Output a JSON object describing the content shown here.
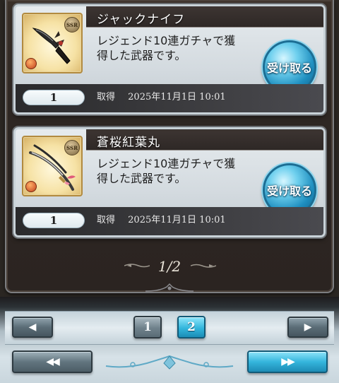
{
  "items": [
    {
      "name": "ジャックナイフ",
      "description_line1": "レジェンド10連ガチャで獲",
      "description_line2": "得した武器です。",
      "quantity": "1",
      "acquired_label": "取得",
      "acquired_date": "2025年11月1日 10:01",
      "receive_label": "受け取る",
      "rarity_badge": "SSR",
      "icon": "dagger-icon",
      "element_color": "#e0601f"
    },
    {
      "name": "蒼桜紅葉丸",
      "description_line1": "レジェンド10連ガチャで獲",
      "description_line2": "得した武器です。",
      "quantity": "1",
      "acquired_label": "取得",
      "acquired_date": "2025年11月1日 10:01",
      "receive_label": "受け取る",
      "rarity_badge": "SSR",
      "icon": "katana-icon",
      "element_color": "#e0601f"
    }
  ],
  "pagination": {
    "indicator": "1/2",
    "prev_icon": "◀",
    "next_icon": "▶",
    "first_icon": "◀◀",
    "last_icon": "▶▶",
    "pages": [
      "1",
      "2"
    ],
    "current_page": "2"
  },
  "colors": {
    "accent_blue": "#33b6dc",
    "panel_dark": "#2e2723",
    "card_light": "#dfe5e9"
  }
}
